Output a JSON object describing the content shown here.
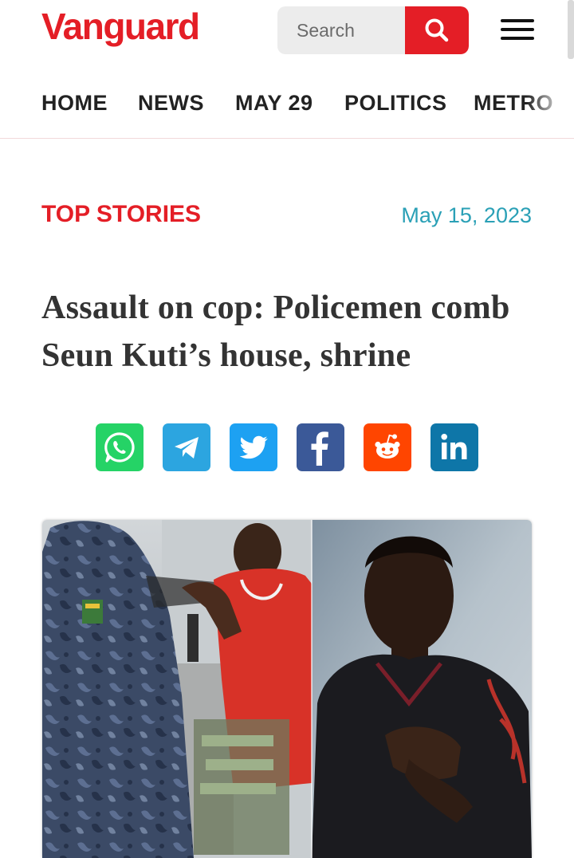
{
  "header": {
    "logo_text": "Vanguard",
    "search": {
      "placeholder": "Search",
      "icon": "search-icon"
    },
    "menu_icon": "hamburger-menu-icon"
  },
  "nav": {
    "items": [
      {
        "label": "HOME"
      },
      {
        "label": "NEWS"
      },
      {
        "label": "MAY 29"
      },
      {
        "label": "POLITICS"
      },
      {
        "label": "METRO"
      }
    ]
  },
  "article": {
    "category": "TOP STORIES",
    "date": "May 15, 2023",
    "headline": "Assault on cop: Policemen comb Seun Kuti’s house, shrine",
    "share_buttons": [
      {
        "icon": "whatsapp-icon",
        "color": "#25d366"
      },
      {
        "icon": "telegram-icon",
        "color": "#2ca5e0"
      },
      {
        "icon": "twitter-icon",
        "color": "#1da1f2"
      },
      {
        "icon": "facebook-icon",
        "color": "#3b5998"
      },
      {
        "icon": "reddit-icon",
        "color": "#ff4500"
      },
      {
        "icon": "linkedin-icon",
        "color": "#0e76a8"
      }
    ]
  },
  "colors": {
    "brand": "#e41e26",
    "date": "#2aa0b6",
    "headline": "#333333"
  }
}
